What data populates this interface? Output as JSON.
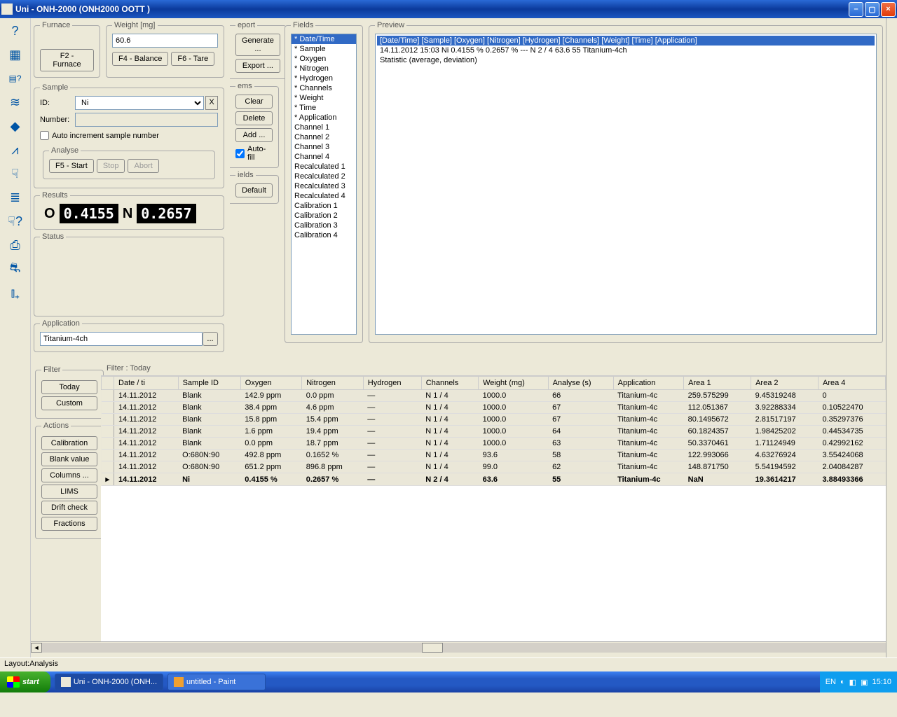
{
  "window": {
    "title": "Uni - ONH-2000 (ONH2000 OOTT )"
  },
  "furnace": {
    "legend": "Furnace",
    "btn_f2": "F2 - Furnace"
  },
  "weight": {
    "legend": "Weight [mg]",
    "value": "60.6",
    "btn_f4": "F4 - Balance",
    "btn_f6": "F6 - Tare"
  },
  "sample": {
    "legend": "Sample",
    "id_label": "ID:",
    "id_value": "Ni",
    "number_label": "Number:",
    "number_value": "",
    "auto_increment": "Auto increment sample number"
  },
  "analyse": {
    "legend": "Analyse",
    "start": "F5 - Start",
    "stop": "Stop",
    "abort": "Abort"
  },
  "report": {
    "legend": "eport",
    "generate": "Generate ...",
    "export": "Export ..."
  },
  "items": {
    "legend": "ems",
    "clear": "Clear",
    "delete": "Delete",
    "add": "Add ...",
    "autofill": "Auto-fill"
  },
  "fields_btns": {
    "legend": "ields",
    "default": "Default"
  },
  "results": {
    "legend": "Results",
    "o_label": "O",
    "o_value": "0.4155",
    "n_label": "N",
    "n_value": "0.2657"
  },
  "status": {
    "legend": "Status"
  },
  "application": {
    "legend": "Application",
    "value": "Titanium-4ch"
  },
  "fields": {
    "legend": "Fields",
    "items": [
      "* Date/Time",
      "* Sample",
      "* Oxygen",
      "* Nitrogen",
      "* Hydrogen",
      "* Channels",
      "* Weight",
      "* Time",
      "* Application",
      "Channel 1",
      "Channel 2",
      "Channel 3",
      "Channel 4",
      "Recalculated 1",
      "Recalculated 2",
      "Recalculated 3",
      "Recalculated 4",
      "Calibration 1",
      "Calibration 2",
      "Calibration 3",
      "Calibration 4"
    ]
  },
  "preview": {
    "legend": "Preview",
    "header": "[Date/Time]   [Sample]   [Oxygen]   [Nitrogen]   [Hydrogen]   [Channels]   [Weight]   [Time]   [Application]",
    "line1": "14.11.2012 15:03   Ni   0.4155 %   0.2657 %   ---   N 2 / 4   63.6   55   Titanium-4ch",
    "line2": "Statistic (average, deviation)"
  },
  "filter": {
    "legend": "Filter",
    "today": "Today",
    "custom": "Custom",
    "label": "Filter : Today"
  },
  "actions": {
    "legend": "Actions",
    "calibration": "Calibration",
    "blank": "Blank value",
    "columns": "Columns ...",
    "lims": "LIMS",
    "drift": "Drift check",
    "fractions": "Fractions"
  },
  "table": {
    "headers": [
      "",
      "Date / ti",
      "Sample ID",
      "Oxygen",
      "Nitrogen",
      "Hydrogen",
      "Channels",
      "Weight (mg)",
      "Analyse (s)",
      "Application",
      "Area 1",
      "Area 2",
      "Area 4"
    ],
    "rows": [
      [
        "14.11.2012",
        "Blank",
        "142.9 ppm",
        "0.0 ppm",
        "—",
        "N 1 / 4",
        "1000.0",
        "66",
        "Titanium-4c",
        "259.575299",
        "9.45319248",
        "0"
      ],
      [
        "14.11.2012",
        "Blank",
        "38.4 ppm",
        "4.6 ppm",
        "—",
        "N 1 / 4",
        "1000.0",
        "67",
        "Titanium-4c",
        "112.051367",
        "3.92288334",
        "0.10522470"
      ],
      [
        "14.11.2012",
        "Blank",
        "15.8 ppm",
        "15.4 ppm",
        "—",
        "N 1 / 4",
        "1000.0",
        "67",
        "Titanium-4c",
        "80.1495672",
        "2.81517197",
        "0.35297376"
      ],
      [
        "14.11.2012",
        "Blank",
        "1.6 ppm",
        "19.4 ppm",
        "—",
        "N 1 / 4",
        "1000.0",
        "64",
        "Titanium-4c",
        "60.1824357",
        "1.98425202",
        "0.44534735"
      ],
      [
        "14.11.2012",
        "Blank",
        "0.0 ppm",
        "18.7 ppm",
        "—",
        "N 1 / 4",
        "1000.0",
        "63",
        "Titanium-4c",
        "50.3370461",
        "1.71124949",
        "0.42992162"
      ],
      [
        "14.11.2012",
        "O:680N:90",
        "492.8 ppm",
        "0.1652 %",
        "—",
        "N 1 / 4",
        "93.6",
        "58",
        "Titanium-4c",
        "122.993066",
        "4.63276924",
        "3.55424068"
      ],
      [
        "14.11.2012",
        "O:680N:90",
        "651.2 ppm",
        "896.8 ppm",
        "—",
        "N 1 / 4",
        "99.0",
        "62",
        "Titanium-4c",
        "148.871750",
        "5.54194592",
        "2.04084287"
      ],
      [
        "14.11.2012",
        "Ni",
        "0.4155 %",
        "0.2657 %",
        "—",
        "N 2 / 4",
        "63.6",
        "55",
        "Titanium-4c",
        "NaN",
        "19.3614217",
        "3.88493366"
      ]
    ]
  },
  "statusbar": "Layout:Analysis",
  "taskbar": {
    "start": "start",
    "task1": "Uni - ONH-2000 (ONH...",
    "task2": "untitled - Paint",
    "lang": "EN",
    "time": "15:10"
  }
}
